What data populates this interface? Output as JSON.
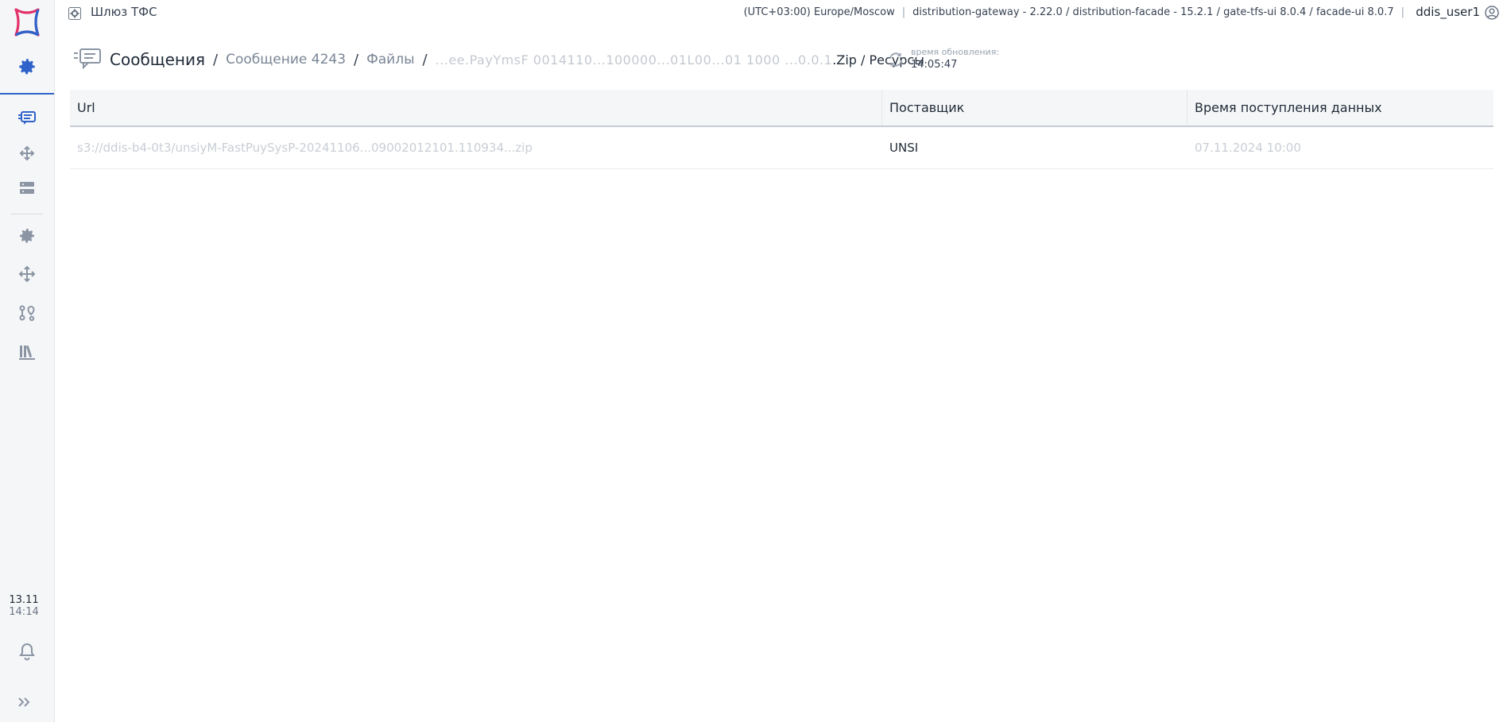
{
  "app": {
    "title": "Шлюз ТФС",
    "timezone": "(UTC+03:00) Europe/Moscow",
    "versions": "distribution-gateway - 2.22.0 / distribution-facade - 15.2.1 / gate-tfs-ui 8.0.4 / facade-ui 8.0.7",
    "user": "ddis_user1"
  },
  "sidebar": {
    "date": "13.11",
    "time": "14:14",
    "accent_color": "#2f63c9"
  },
  "breadcrumb": {
    "root": "Сообщения",
    "separator": "/",
    "message": "Сообщение 4243",
    "files": "Файлы",
    "file_name": "...ee.PayYmsF 0014110...100000...01L00...01 1000 ...0.0.1",
    "tail": ".Zip / Ресурсы"
  },
  "update": {
    "label": "время обновления:",
    "time": "14:05:47"
  },
  "table": {
    "columns": [
      "Url",
      "Поставщик",
      "Время поступления данных"
    ],
    "rows": [
      {
        "url": "s3://ddis-b4-0t3/unsiyM-FastPuySysP-20241106...09002012101.110934...zip",
        "supplier": "UNSI",
        "received": "07.11.2024 10:00"
      }
    ]
  }
}
